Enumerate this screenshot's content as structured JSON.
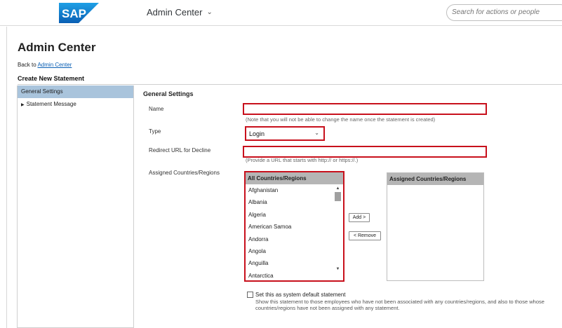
{
  "header": {
    "logo_text": "SAP",
    "app_title": "Admin Center",
    "search_placeholder": "Search for actions or people",
    "brand_color": "#0a6ed1"
  },
  "page": {
    "title": "Admin Center",
    "back_prefix": "Back to",
    "back_link": "Admin Center",
    "section_title": "Create New Statement"
  },
  "nav": {
    "items": [
      {
        "label": "General Settings",
        "selected": true
      },
      {
        "label": "Statement Message",
        "selected": false
      }
    ]
  },
  "form": {
    "heading": "General Settings",
    "name_label": "Name",
    "name_value": "",
    "name_hint": "(Note that you will not be able to change the name once the statement is created)",
    "type_label": "Type",
    "type_value": "Login",
    "redirect_label": "Redirect URL for Decline",
    "redirect_value": "",
    "redirect_hint": "(Provide a URL that starts with http:// or https://.)",
    "countries_label": "Assigned Countries/Regions",
    "all_list_header": "All Countries/Regions",
    "all_countries": [
      "Afghanistan",
      "Albania",
      "Algeria",
      "American Samoa",
      "Andorra",
      "Angola",
      "Anguilla",
      "Antarctica"
    ],
    "assigned_list_header": "Assigned Countries/Regions",
    "add_button": "Add >",
    "remove_button": "< Remove",
    "default_checkbox_label": "Set this as system default statement",
    "default_checkbox_desc": "Show this statement to those employees who have not been associated with any countries/regions, and also to those whose countries/regions have not been assigned with any statement.",
    "highlight_color": "#c8101c"
  }
}
